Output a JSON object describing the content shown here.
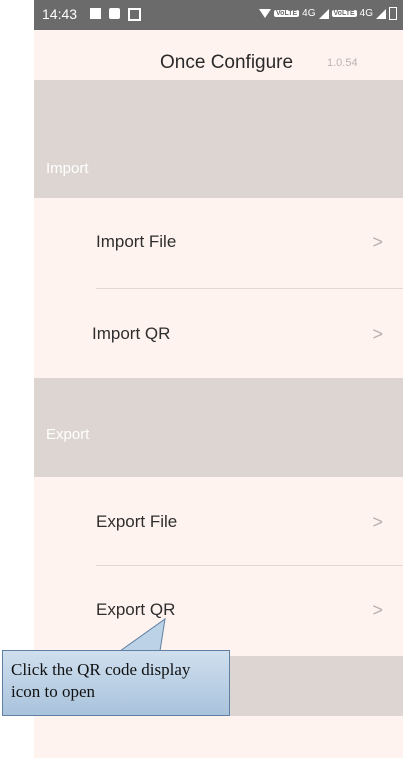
{
  "status_bar": {
    "time": "14:43",
    "network_left": "4G",
    "network_right": "4G",
    "volte": "VoLTE",
    "icons": [
      "image-icon",
      "message-icon",
      "barcode-icon",
      "wifi-icon",
      "signal-icon",
      "battery-icon"
    ]
  },
  "header": {
    "title": "Once Configure",
    "version": "1.0.54"
  },
  "sections": {
    "import": {
      "label": "Import",
      "items": [
        {
          "label": "Import File",
          "chevron": ">"
        },
        {
          "label": "Import QR",
          "chevron": ">"
        }
      ]
    },
    "export": {
      "label": "Export",
      "items": [
        {
          "label": "Export File",
          "chevron": ">"
        },
        {
          "label": "Export QR",
          "chevron": ">"
        }
      ]
    }
  },
  "callout": {
    "line1": "Click the QR code display",
    "line2": "icon to open"
  },
  "colors": {
    "background": "#fff3ef",
    "section_header": "#dcd5d2",
    "status_bar": "#6b6b6b",
    "callout_fill": "#bcd2e7",
    "callout_border": "#5f7fa3"
  }
}
